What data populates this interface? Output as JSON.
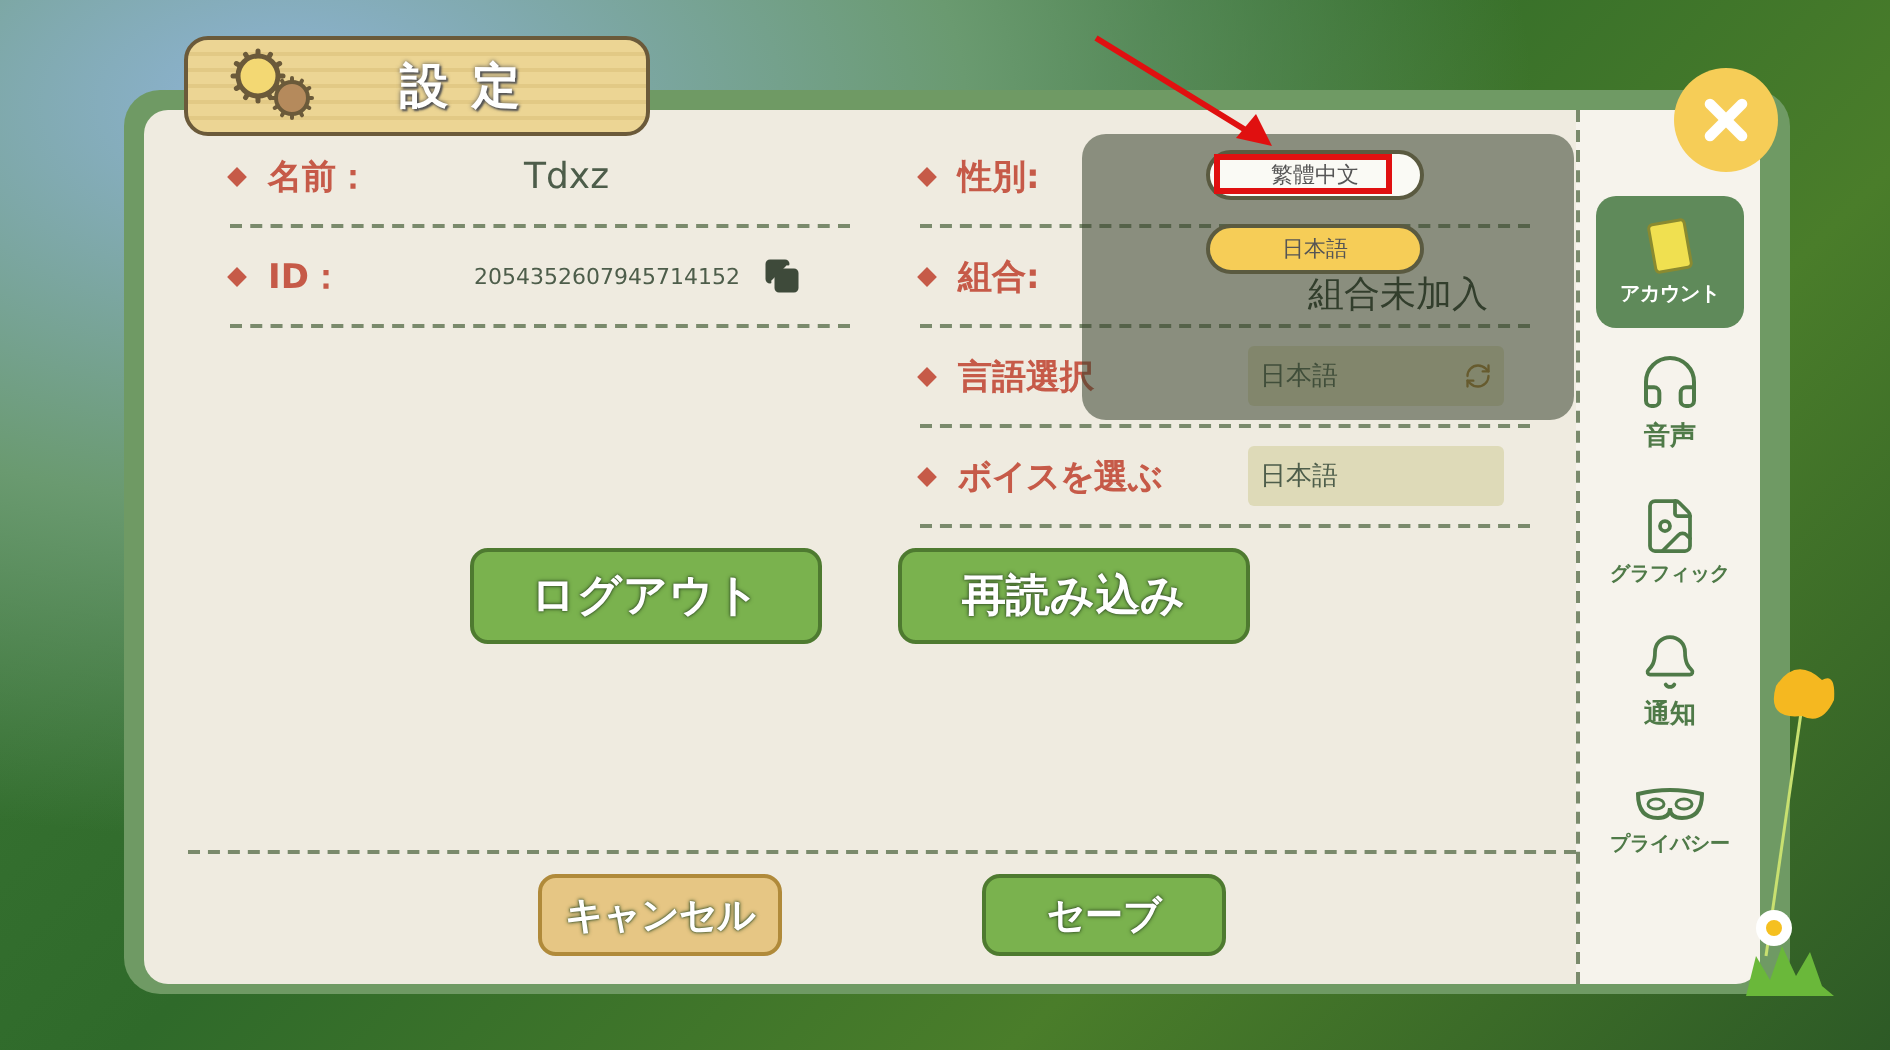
{
  "header": {
    "title": "設定"
  },
  "profile_fields": [
    {
      "label": "名前：",
      "value": "Tdxz",
      "kind": "text"
    },
    {
      "label": "ID：",
      "value": "2054352607945714152",
      "kind": "copyable"
    }
  ],
  "settings_fields": [
    {
      "label": "性別:",
      "kind": "gender"
    },
    {
      "label": "組合:",
      "value": "組合未加入",
      "kind": "text"
    },
    {
      "label": "言語選択",
      "value": "日本語",
      "kind": "select"
    },
    {
      "label": "ボイスを選ぶ",
      "value": "日本語",
      "kind": "input"
    }
  ],
  "action_buttons": [
    {
      "label": "ログアウト",
      "kind": "primary"
    },
    {
      "label": "再読み込み",
      "kind": "primary"
    }
  ],
  "footer_buttons": [
    {
      "label": "キャンセル",
      "kind": "secondary"
    },
    {
      "label": "セーブ",
      "kind": "primary"
    }
  ],
  "language_dropdown": {
    "options": [
      {
        "label": "繁體中文",
        "selected": false,
        "highlighted": true
      },
      {
        "label": "日本語",
        "selected": true,
        "highlighted": false
      }
    ]
  },
  "sidebar": {
    "items": [
      {
        "label": "アカウント",
        "selected": true
      },
      {
        "label": "音声",
        "selected": false
      },
      {
        "label": "グラフィック",
        "selected": false
      },
      {
        "label": "通知",
        "selected": false
      },
      {
        "label": "プライバシー",
        "selected": false
      }
    ]
  }
}
